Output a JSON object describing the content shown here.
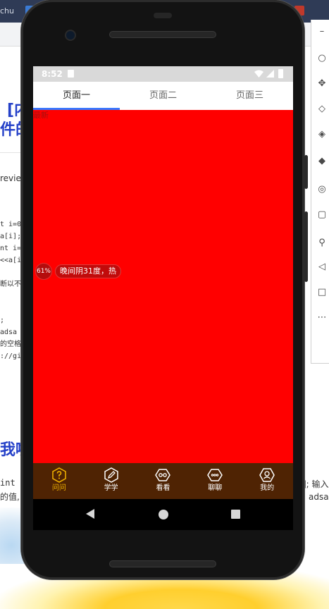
{
  "background": {
    "browser_tab_fragment": "chu",
    "page_heading_1": "[内",
    "page_heading_2": "件的",
    "page_heading_3": "我啦",
    "review_text": "review",
    "code_lines": [
      "t i=0",
      "a[i];",
      "nt i=",
      "<<a[i",
      "",
      "断以不会",
      "",
      "",
      ";",
      "adsa",
      "的空格",
      "://gi"
    ],
    "bottom_text_1": "int a",
    "bottom_text_2": "的值,",
    "right_text_1": "]; 输入",
    "right_text_2": "adsa"
  },
  "status_bar": {
    "time": "8:52"
  },
  "tabs": [
    {
      "label": "页面一",
      "active": true
    },
    {
      "label": "页面二",
      "active": false
    },
    {
      "label": "页面三",
      "active": false
    }
  ],
  "content": {
    "background_color": "#ff0000",
    "refresh_label": "最新",
    "weather": {
      "percent": "61%",
      "text": "晚间阴31度，热"
    }
  },
  "bottom_nav": {
    "background_color": "#4f2303",
    "active_color": "#f4b400",
    "items": [
      {
        "label": "问问",
        "icon": "question-icon",
        "active": true
      },
      {
        "label": "学学",
        "icon": "pencil-icon",
        "active": false
      },
      {
        "label": "看看",
        "icon": "glasses-icon",
        "active": false
      },
      {
        "label": "聊聊",
        "icon": "chat-icon",
        "active": false
      },
      {
        "label": "我的",
        "icon": "person-icon",
        "active": false
      }
    ]
  },
  "system_nav": {
    "back": "back-icon",
    "home": "home-icon",
    "recents": "recents-icon"
  }
}
